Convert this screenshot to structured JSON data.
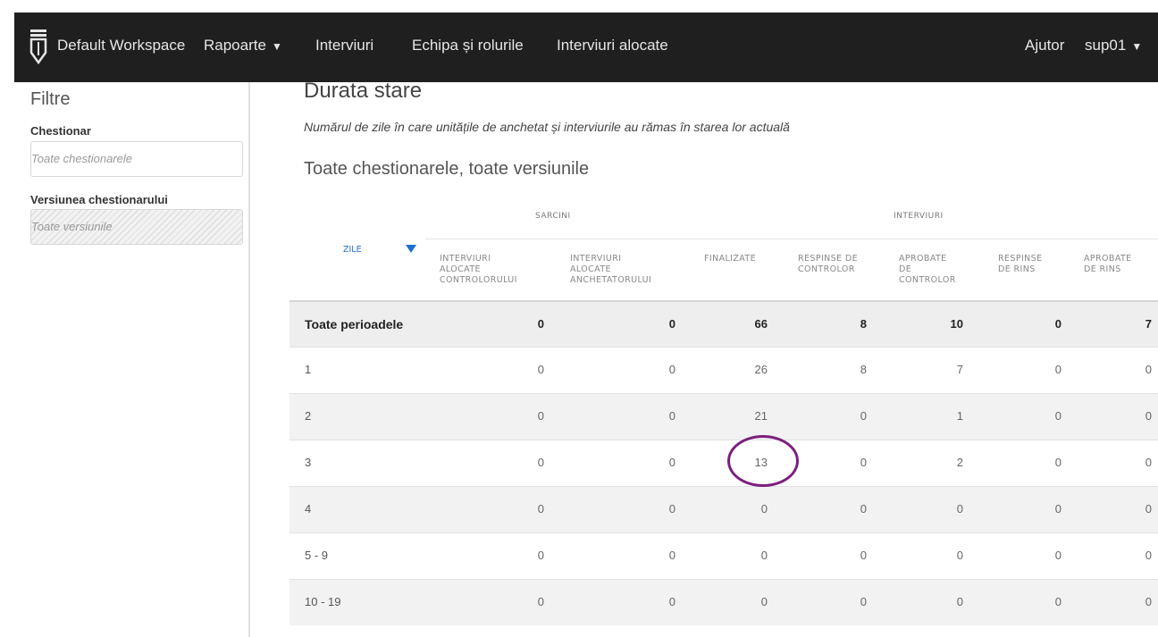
{
  "nav": {
    "workspace": "Default Workspace",
    "items": [
      "Rapoarte",
      "Interviuri",
      "Echipa și rolurile",
      "Interviuri alocate"
    ],
    "caret": "▼",
    "help": "Ajutor",
    "user": "sup01"
  },
  "sidebar": {
    "title": "Filtre",
    "questionnaire_label": "Chestionar",
    "questionnaire_placeholder": "Toate chestionarele",
    "version_label": "Versiunea chestionarului",
    "version_placeholder": "Toate versiunile"
  },
  "main": {
    "title": "Durata stare",
    "subtitle": "Numărul de zile în care unitățile de anchetat și interviurile au rămas în starea lor actuală",
    "section_title": "Toate chestionarele, toate versiunile"
  },
  "table": {
    "groups": [
      "SARCINI",
      "INTERVIURI"
    ],
    "sort_column": "ZILE",
    "columns": [
      [
        "INTERVIURI",
        "ALOCATE",
        "CONTROLORULUI"
      ],
      [
        "INTERVIURI",
        "ALOCATE",
        "ANCHETATORULUI"
      ],
      [
        "FINALIZATE"
      ],
      [
        "RESPINSE DE",
        "CONTROLOR"
      ],
      [
        "APROBATE",
        "DE",
        "CONTROLOR"
      ],
      [
        "RESPINSE",
        "DE RINS"
      ],
      [
        "APROBATE",
        "DE RINS"
      ]
    ],
    "rows": [
      {
        "label": "Toate perioadele",
        "values": [
          "0",
          "0",
          "66",
          "8",
          "10",
          "0",
          "7"
        ],
        "total": true
      },
      {
        "label": "1",
        "values": [
          "0",
          "0",
          "26",
          "8",
          "7",
          "0",
          "0"
        ]
      },
      {
        "label": "2",
        "values": [
          "0",
          "0",
          "21",
          "0",
          "1",
          "0",
          "0"
        ]
      },
      {
        "label": "3",
        "values": [
          "0",
          "0",
          "13",
          "0",
          "2",
          "0",
          "0"
        ]
      },
      {
        "label": "4",
        "values": [
          "0",
          "0",
          "0",
          "0",
          "0",
          "0",
          "0"
        ]
      },
      {
        "label": "5 - 9",
        "values": [
          "0",
          "0",
          "0",
          "0",
          "0",
          "0",
          "0"
        ]
      },
      {
        "label": "10 - 19",
        "values": [
          "0",
          "0",
          "0",
          "0",
          "0",
          "0",
          "0"
        ]
      }
    ]
  },
  "annotation": {
    "color": "#7b1f7e",
    "highlighted_value": "13"
  }
}
